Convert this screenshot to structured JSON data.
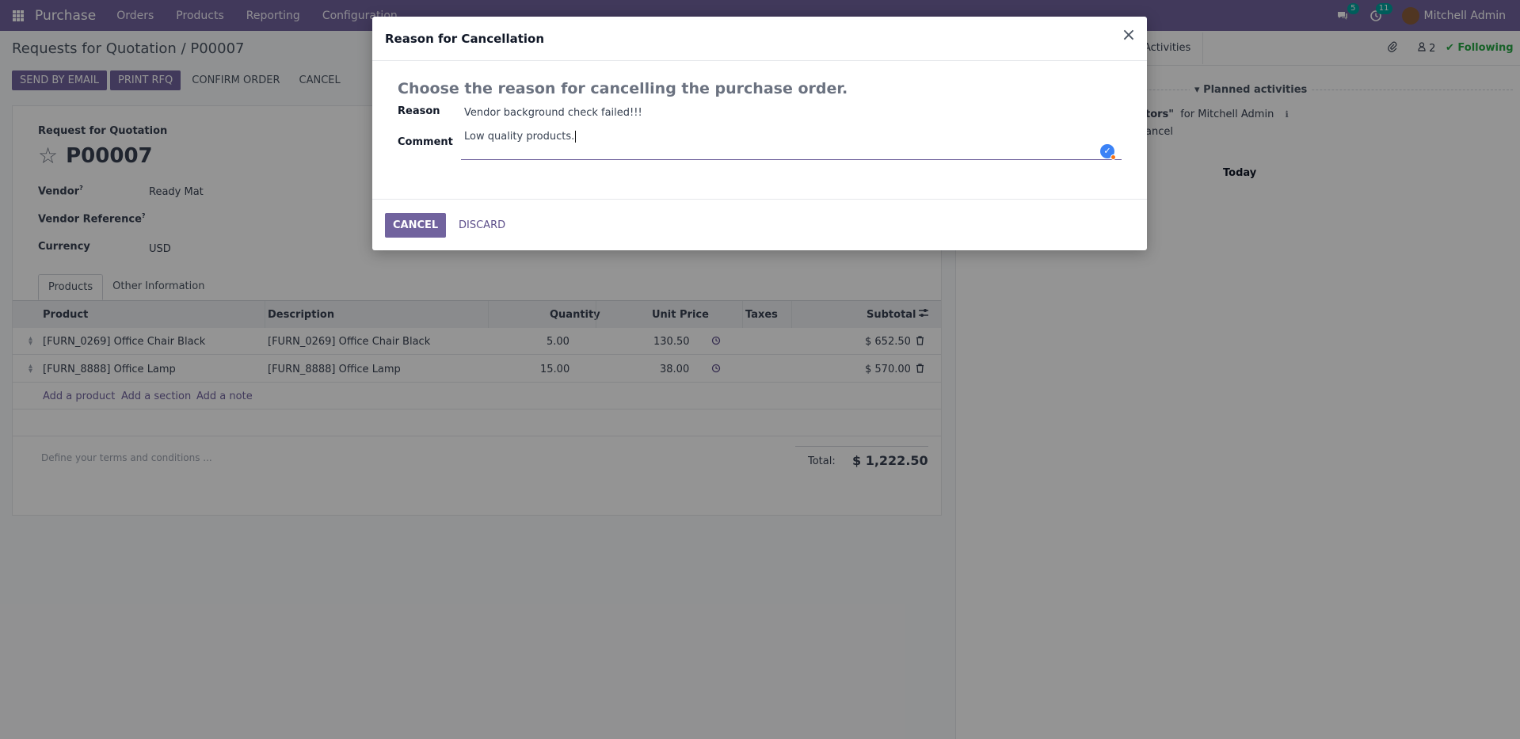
{
  "navbar": {
    "brand": "Purchase",
    "menu": [
      "Orders",
      "Products",
      "Reporting",
      "Configuration"
    ],
    "messages_count": "5",
    "activities_count": "11",
    "user": "Mitchell Admin",
    "bg_color": "#71639e"
  },
  "breadcrumb": "Requests for Quotation / P00007",
  "actions": {
    "send_by_email": "SEND BY EMAIL",
    "print_rfq": "PRINT RFQ",
    "confirm_order": "CONFIRM ORDER",
    "cancel": "CANCEL"
  },
  "form": {
    "doc_type": "Request for Quotation",
    "name": "P00007",
    "vendor_label": "Vendor",
    "vendor": "Ready Mat",
    "vendor_ref_label": "Vendor Reference",
    "currency_label": "Currency",
    "currency": "USD",
    "help_mark": "?",
    "tabs": [
      "Products",
      "Other Information"
    ],
    "columns": [
      "Product",
      "Description",
      "Quantity",
      "Unit Price",
      "Taxes",
      "Subtotal"
    ],
    "lines": [
      {
        "product": "[FURN_0269] Office Chair Black",
        "description": "[FURN_0269] Office Chair Black",
        "quantity": "5.00",
        "unit_price": "130.50",
        "subtotal": "$ 652.50"
      },
      {
        "product": "[FURN_8888] Office Lamp",
        "description": "[FURN_8888] Office Lamp",
        "quantity": "15.00",
        "unit_price": "38.00",
        "subtotal": "$ 570.00"
      }
    ],
    "add_product": "Add a product",
    "add_section": "Add a section",
    "add_note": "Add a note",
    "terms_placeholder": "Define your terms and conditions ...",
    "total_label": "Total:",
    "total": "$ 1,222.50"
  },
  "chatter": {
    "activities": "Activities",
    "followers_count": "2",
    "following": "Following",
    "planned_activities": "Planned activities",
    "activity_line1_a": "tors\"",
    "activity_line1_b": "for Mitchell Admin",
    "activity_line2": "ancel",
    "today": "Today"
  },
  "modal": {
    "title": "Reason for Cancellation",
    "lead": "Choose the reason for cancelling the purchase order.",
    "reason_label": "Reason",
    "reason_value": "Vendor background check failed!!!",
    "comment_label": "Comment",
    "comment_value": "Low quality products.",
    "cancel_button": "CANCEL",
    "discard_button": "DISCARD"
  }
}
